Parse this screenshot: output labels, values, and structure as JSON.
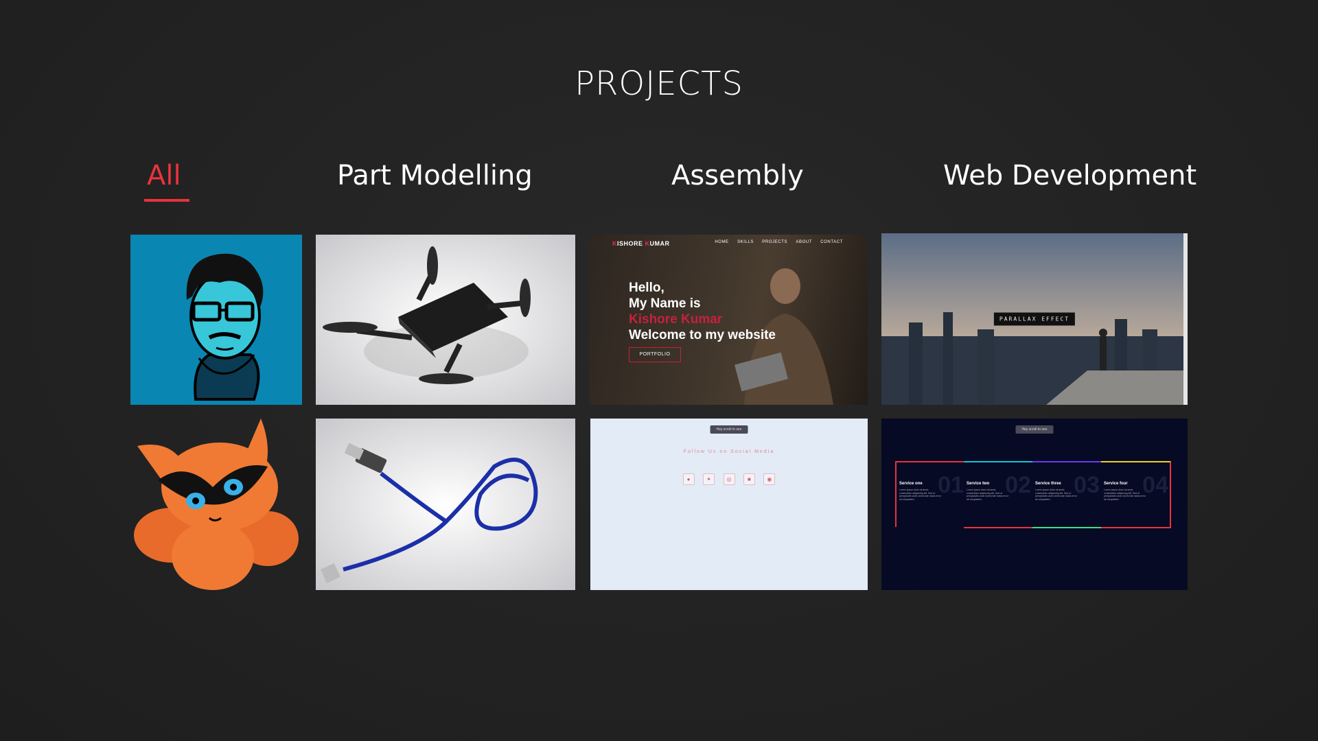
{
  "page": {
    "title": "PROJECTS"
  },
  "tabs": [
    {
      "label": "All",
      "active": true
    },
    {
      "label": "Part Modelling",
      "active": false
    },
    {
      "label": "Assembly",
      "active": false
    },
    {
      "label": "Web Development",
      "active": false
    }
  ],
  "colors": {
    "accent": "#e8333c",
    "background": "#232323"
  },
  "cards": {
    "hero": {
      "brand_first": "K",
      "brand_middle": "ISHORE ",
      "brand_second": "K",
      "brand_last": "UMAR",
      "nav": [
        "HOME",
        "SKILLS",
        "PROJECTS",
        "ABOUT",
        "CONTACT"
      ],
      "greeting": "Hello,",
      "name_line": "My Name is",
      "name": "Kishore Kumar",
      "welcome": "Welcome to my website",
      "button": "PORTFOLIO"
    },
    "parallax": {
      "label": "PARALLAX EFFECT"
    },
    "social": {
      "scroll_pill": "Hey scroll to see",
      "title": "Follow Us on Social Media",
      "icons": [
        "pinterest-icon",
        "twitter-icon",
        "whatsapp-icon",
        "linkedin-icon",
        "github-icon"
      ]
    },
    "services": {
      "scroll_pill": "Hey scroll to see",
      "items": [
        {
          "name": "Service one",
          "num": "01",
          "text": "Lorem ipsum dolor sit amet, consectetur adipiscing elit. Sed ut perspiciatis unde omnis iste natus error sit voluptatem."
        },
        {
          "name": "Service two",
          "num": "02",
          "text": "Lorem ipsum dolor sit amet, consectetur adipiscing elit. Sed ut perspiciatis unde omnis iste natus error sit voluptatem."
        },
        {
          "name": "Service three",
          "num": "03",
          "text": "Lorem ipsum dolor sit amet, consectetur adipiscing elit. Sed ut perspiciatis unde omnis iste natus error sit voluptatem."
        },
        {
          "name": "Service four",
          "num": "04",
          "text": "Lorem ipsum dolor sit amet, consectetur adipiscing elit. Sed ut perspiciatis unde omnis iste natus error sit voluptatem."
        }
      ]
    }
  }
}
